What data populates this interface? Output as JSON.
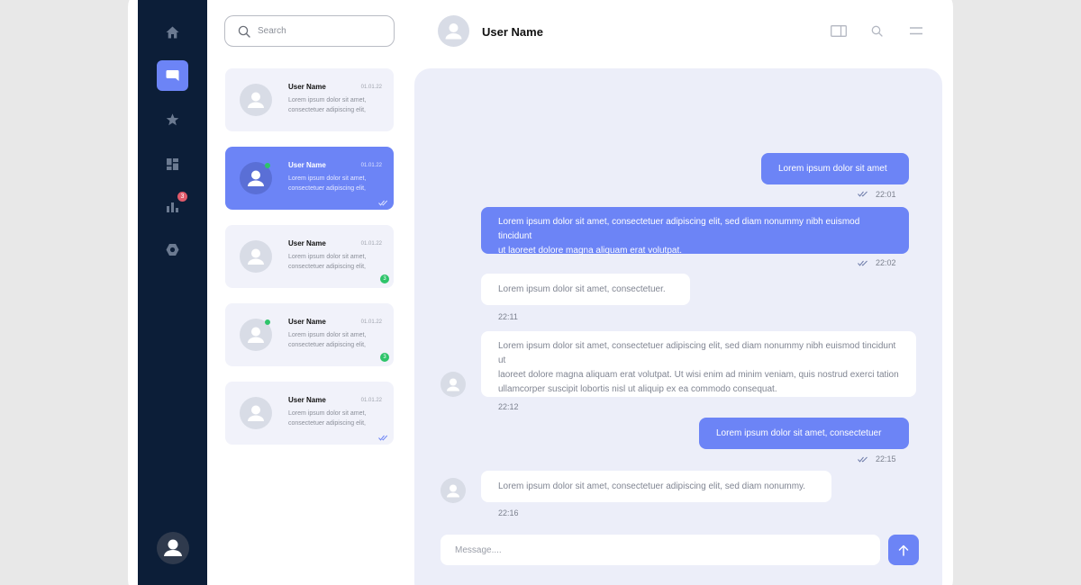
{
  "search": {
    "placeholder": "Search"
  },
  "sidebar": {
    "items": [
      {
        "name": "home",
        "icon": "home-icon"
      },
      {
        "name": "chat",
        "icon": "chat-bubble-icon",
        "active": true
      },
      {
        "name": "favorites",
        "icon": "star-icon"
      },
      {
        "name": "dashboard",
        "icon": "dashboard-icon"
      },
      {
        "name": "stats",
        "icon": "bar-chart-icon",
        "badge": "3"
      },
      {
        "name": "settings",
        "icon": "hexagon-icon"
      }
    ]
  },
  "conversations": [
    {
      "name": "User Name",
      "date": "01.01.22",
      "preview": "Lorem ipsum dolor sit amet, consectetuer adipiscing elit,",
      "online": false,
      "unread": null,
      "read": false
    },
    {
      "name": "User Name",
      "date": "01.01.22",
      "preview": "Lorem ipsum dolor sit amet, consectetuer adipiscing elit,",
      "online": true,
      "unread": null,
      "read": true
    },
    {
      "name": "User Name",
      "date": "01.01.22",
      "preview": "Lorem ipsum dolor sit amet, consectetuer adipiscing elit,",
      "online": false,
      "unread": "3",
      "read": false
    },
    {
      "name": "User Name",
      "date": "01.01.22",
      "preview": "Lorem ipsum dolor sit amet, consectetuer adipiscing elit,",
      "online": true,
      "unread": "3",
      "read": false
    },
    {
      "name": "User Name",
      "date": "01.01.22",
      "preview": "Lorem ipsum dolor sit amet, consectetuer adipiscing elit,",
      "online": false,
      "unread": null,
      "read": true
    }
  ],
  "header": {
    "name": "User Name"
  },
  "messages": [
    {
      "dir": "out",
      "lines": [
        "Lorem ipsum dolor sit amet"
      ],
      "time": "22:01"
    },
    {
      "dir": "out",
      "lines": [
        "Lorem ipsum dolor sit amet, consectetuer adipiscing elit, sed diam nonummy nibh euismod tincidunt",
        "ut laoreet dolore magna aliquam erat volutpat."
      ],
      "time": "22:02"
    },
    {
      "dir": "in",
      "lines": [
        "Lorem ipsum dolor sit amet, consectetuer."
      ],
      "time": "22:11"
    },
    {
      "dir": "in",
      "lines": [
        "Lorem ipsum dolor sit amet, consectetuer adipiscing elit, sed diam nonummy nibh euismod tincidunt ut",
        "laoreet dolore magna aliquam erat volutpat. Ut wisi enim ad minim veniam, quis nostrud exerci tation",
        "ullamcorper suscipit lobortis nisl ut aliquip ex ea commodo consequat."
      ],
      "time": "22:12"
    },
    {
      "dir": "out",
      "lines": [
        "Lorem ipsum dolor sit amet, consectetuer"
      ],
      "time": "22:15"
    },
    {
      "dir": "in",
      "lines": [
        "Lorem ipsum dolor sit amet, consectetuer adipiscing elit, sed diam nonummy."
      ],
      "time": "22:16"
    }
  ],
  "composer": {
    "placeholder": "Message...."
  },
  "colors": {
    "accent": "#6c84f6",
    "sidebar": "#0c1e38",
    "online": "#2ec46a",
    "badge": "#e05a6a"
  }
}
